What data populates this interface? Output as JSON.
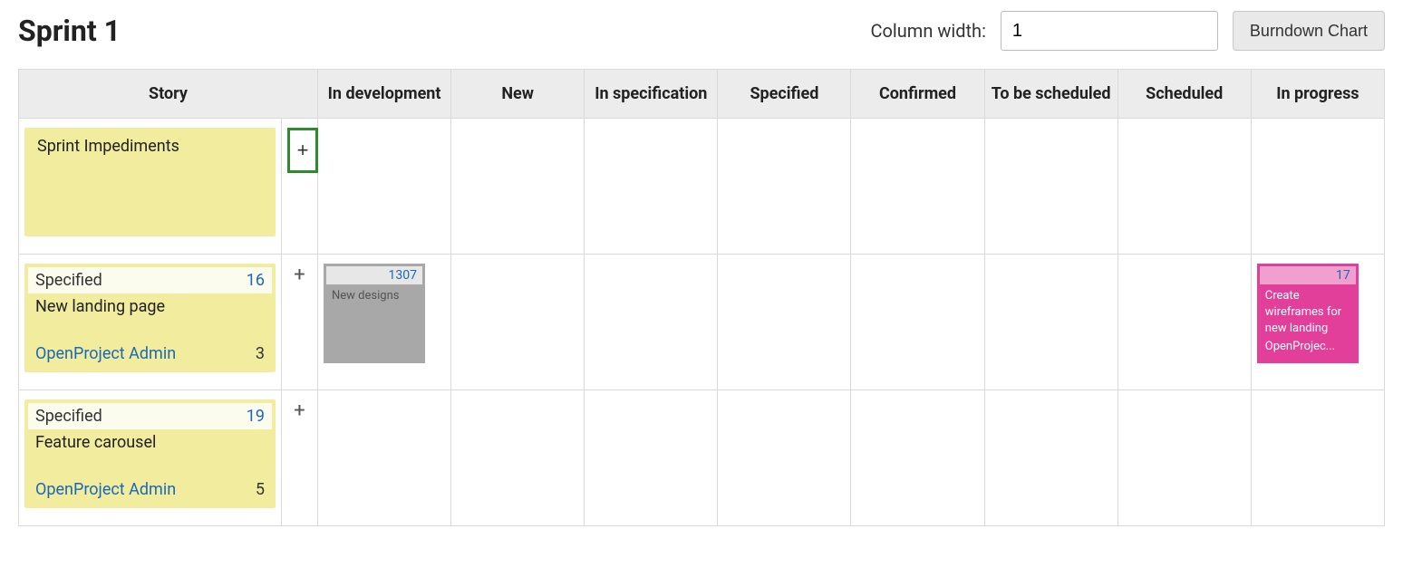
{
  "header": {
    "title": "Sprint 1",
    "col_width_label": "Column width:",
    "col_width_value": "1",
    "burndown_label": "Burndown Chart"
  },
  "columns": [
    "Story",
    "In development",
    "New",
    "In specification",
    "Specified",
    "Confirmed",
    "To be scheduled",
    "Scheduled",
    "In progress"
  ],
  "rows": [
    {
      "story": {
        "title": "Sprint Impediments"
      },
      "add_style": "green",
      "tasks": {
        "in_development": null,
        "in_progress": null
      }
    },
    {
      "story": {
        "status": "Specified",
        "id": "16",
        "title": "New landing page",
        "owner": "OpenProject Admin",
        "points": "3"
      },
      "add_style": "plain",
      "tasks": {
        "in_development": {
          "id": "1307",
          "title": "New designs",
          "color": "gray"
        },
        "in_progress": {
          "id": "17",
          "title": "Create wireframes for new landing",
          "owner": "OpenProjec...",
          "color": "pink"
        }
      }
    },
    {
      "story": {
        "status": "Specified",
        "id": "19",
        "title": "Feature carousel",
        "owner": "OpenProject Admin",
        "points": "5"
      },
      "add_style": "plain",
      "tasks": {
        "in_development": null,
        "in_progress": null
      }
    }
  ]
}
